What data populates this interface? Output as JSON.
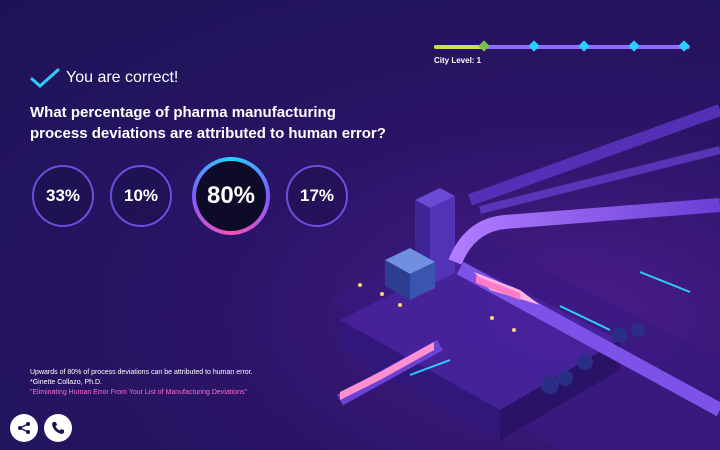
{
  "level": {
    "label": "City Level: 1",
    "progress_fraction": 0.2
  },
  "feedback": {
    "text": "You are correct!",
    "icon": "checkmark-icon"
  },
  "question": {
    "text": "What percentage of pharma manufacturing process deviations are attributed to human error?"
  },
  "answers": [
    {
      "label": "33%",
      "selected": false
    },
    {
      "label": "10%",
      "selected": false
    },
    {
      "label": "80%",
      "selected": true
    },
    {
      "label": "17%",
      "selected": false
    }
  ],
  "footer": {
    "fact": "Upwards of 80% of process deviations can be attributed to human error.",
    "author": "*Ginette Collazo, Ph.D.",
    "source_title": "\"Eliminating Human Error From Your List of Manufacturing Deviations\""
  },
  "buttons": {
    "share_icon": "share-icon",
    "phone_icon": "phone-icon"
  },
  "colors": {
    "background": "#1c1356",
    "accent_cyan": "#29d0ff",
    "accent_pink": "#ff6bd0",
    "progress_done": "#c6e05a",
    "progress_todo": "#8f6bff"
  }
}
